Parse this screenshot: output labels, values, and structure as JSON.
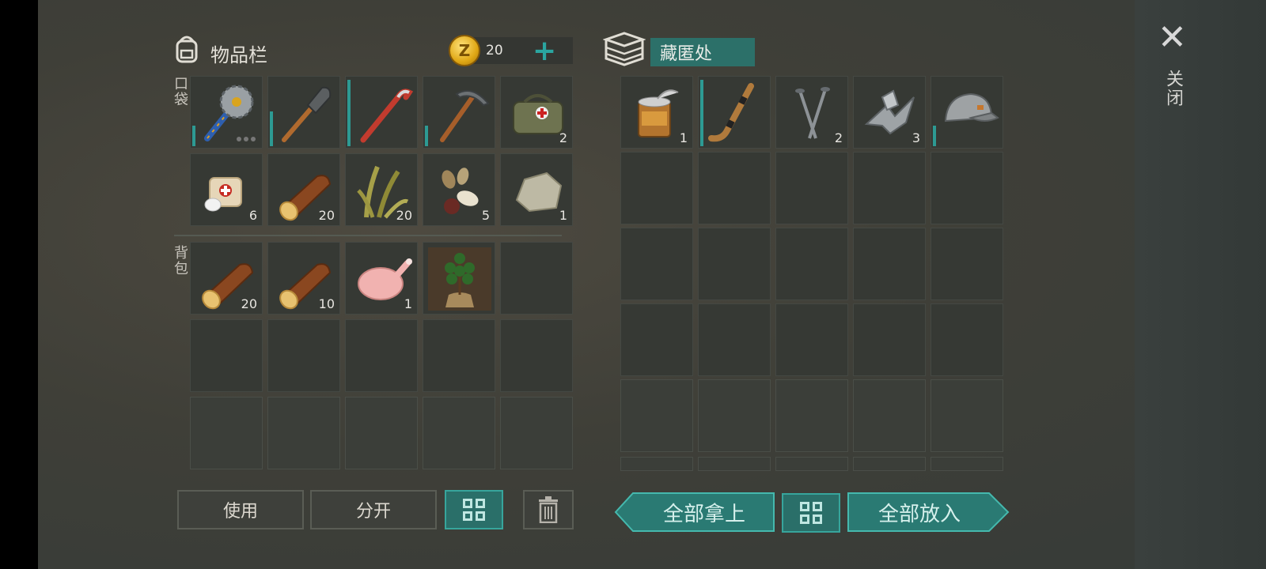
{
  "inventory": {
    "title": "物品栏",
    "coins": "20",
    "coin_symbol": "Z",
    "pocket_label": "口袋",
    "backpack_label": "背包",
    "pocket_items": [
      {
        "icon": "saw-mace-icon",
        "count": "",
        "durability": 0.3,
        "more": true
      },
      {
        "icon": "shovel-icon",
        "count": "",
        "durability": 0.5
      },
      {
        "icon": "crowbar-icon",
        "count": "",
        "durability": 0.95
      },
      {
        "icon": "pickaxe-icon",
        "count": "",
        "durability": 0.3
      },
      {
        "icon": "medkit-bag-icon",
        "count": "2"
      },
      {
        "icon": "bandage-icon",
        "count": "6"
      },
      {
        "icon": "log-icon",
        "count": "20"
      },
      {
        "icon": "plant-fiber-icon",
        "count": "20"
      },
      {
        "icon": "seeds-icon",
        "count": "5"
      },
      {
        "icon": "stone-icon",
        "count": "1"
      }
    ],
    "backpack_items": [
      {
        "icon": "log-icon",
        "count": "20"
      },
      {
        "icon": "log-icon",
        "count": "10"
      },
      {
        "icon": "raw-chicken-icon",
        "count": "1"
      },
      {
        "icon": "potted-sapling-icon",
        "count": ""
      }
    ]
  },
  "stash": {
    "title": "藏匿处",
    "items": [
      {
        "icon": "canned-food-icon",
        "count": "1"
      },
      {
        "icon": "hockey-stick-icon",
        "count": "",
        "durability": 0.95
      },
      {
        "icon": "nails-icon",
        "count": "2"
      },
      {
        "icon": "scrap-metal-icon",
        "count": "3"
      },
      {
        "icon": "baseball-cap-icon",
        "count": "",
        "durability": 0.3
      }
    ]
  },
  "buttons": {
    "use": "使用",
    "split": "分开",
    "take_all": "全部拿上",
    "put_all": "全部放入"
  },
  "close": {
    "label": "关闭",
    "symbol": "✕"
  },
  "colors": {
    "accent_teal": "#2a7a73",
    "durability_bar": "#2d9a93",
    "coin_gold": "#e0a816"
  }
}
